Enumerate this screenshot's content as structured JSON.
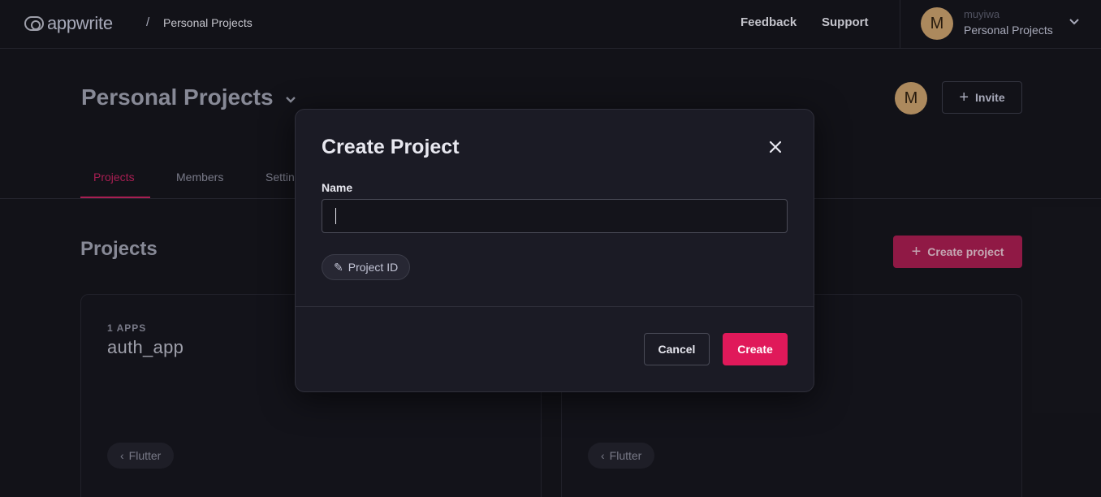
{
  "header": {
    "logo_text": "appwrite",
    "breadcrumb_sep": "/",
    "breadcrumb": "Personal Projects",
    "feedback_label": "Feedback",
    "support_label": "Support",
    "user": {
      "avatar_initial": "M",
      "name": "muyiwa",
      "organization": "Personal Projects",
      "chevron": "⌄"
    }
  },
  "org": {
    "title": "Personal Projects",
    "chevron": "⌄",
    "avatar_initial": "M",
    "invite_label": "Invite",
    "plus": "+"
  },
  "tabs": [
    {
      "label": "Projects",
      "active": true
    },
    {
      "label": "Members",
      "active": false
    },
    {
      "label": "Settings",
      "active": false
    }
  ],
  "projects": {
    "title": "Projects",
    "create_label": "Create project",
    "plus": "+",
    "cards": [
      {
        "apps": "1 APPS",
        "name": "auth_app",
        "platform": "Flutter",
        "platform_icon": "‹"
      },
      {
        "apps": "",
        "name": "",
        "platform": "Flutter",
        "platform_icon": "‹"
      }
    ]
  },
  "modal": {
    "title": "Create Project",
    "close_icon": "✕",
    "name_label": "Name",
    "name_value": "",
    "project_id_label": "Project ID",
    "project_id_icon": "✎",
    "cancel_label": "Cancel",
    "create_label": "Create"
  },
  "colors": {
    "background": "#14141b",
    "accent": "#e0195a",
    "modal": "#1b1b25",
    "avatar": "#c9a06b"
  }
}
